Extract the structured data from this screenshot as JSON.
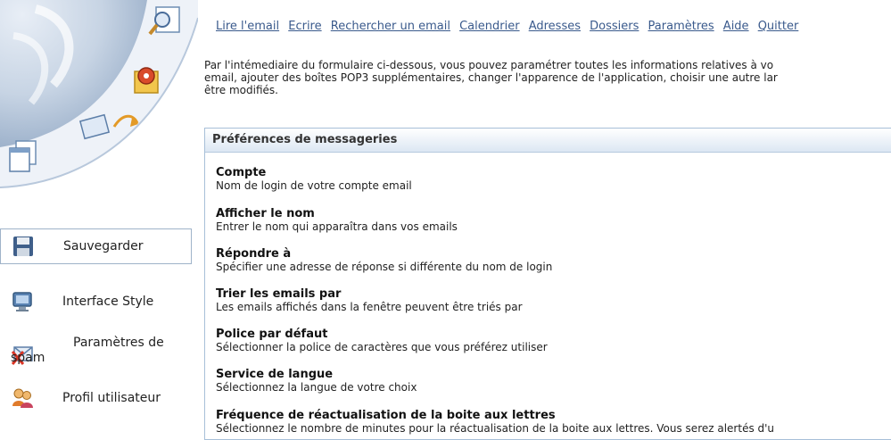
{
  "topnav": {
    "read": "Lire l'email",
    "write": "Ecrire",
    "search": "Rechercher un email",
    "calendar": "Calendrier",
    "addresses": "Adresses",
    "folders": "Dossiers",
    "settings": "Paramètres",
    "help": "Aide",
    "quit": "Quitter"
  },
  "intro": {
    "line1": "Par l'intémediaire du formulaire ci-dessous, vous pouvez paramétrer toutes les informations relatives à vo",
    "line2": "email, ajouter des boîtes POP3 supplémentaires, changer l'apparence de l'application, choisir une autre lar",
    "line3": "être modifiés."
  },
  "sidebar": {
    "save": "Sauvegarder",
    "style": "Interface Style",
    "spam_line1": "Paramètres de",
    "spam_line2": "spam",
    "profile": "Profil utilisateur"
  },
  "panel": {
    "title": "Préférences de messageries",
    "settings": [
      {
        "title": "Compte",
        "desc": "Nom de login de votre compte email"
      },
      {
        "title": "Afficher le nom",
        "desc": "Entrer le nom qui apparaîtra dans vos emails"
      },
      {
        "title": "Répondre à",
        "desc": "Spécifier une adresse de réponse si différente du nom de login"
      },
      {
        "title": "Trier les emails par",
        "desc": "Les emails affichés dans la fenêtre peuvent être triés par"
      },
      {
        "title": "Police par défaut",
        "desc": "Sélectionner la police de caractères que vous préférez utiliser"
      },
      {
        "title": "Service de langue",
        "desc": "Sélectionnez la langue de votre choix"
      },
      {
        "title": "Fréquence de réactualisation de la boite aux lettres",
        "desc": "Sélectionnez le nombre de minutes pour la réactualisation de la boite aux lettres. Vous serez alertés d'u"
      }
    ]
  },
  "colors": {
    "link": "#3a5a8c",
    "panel_border": "#a7bfd8",
    "swoosh": "#c9d6e6"
  }
}
